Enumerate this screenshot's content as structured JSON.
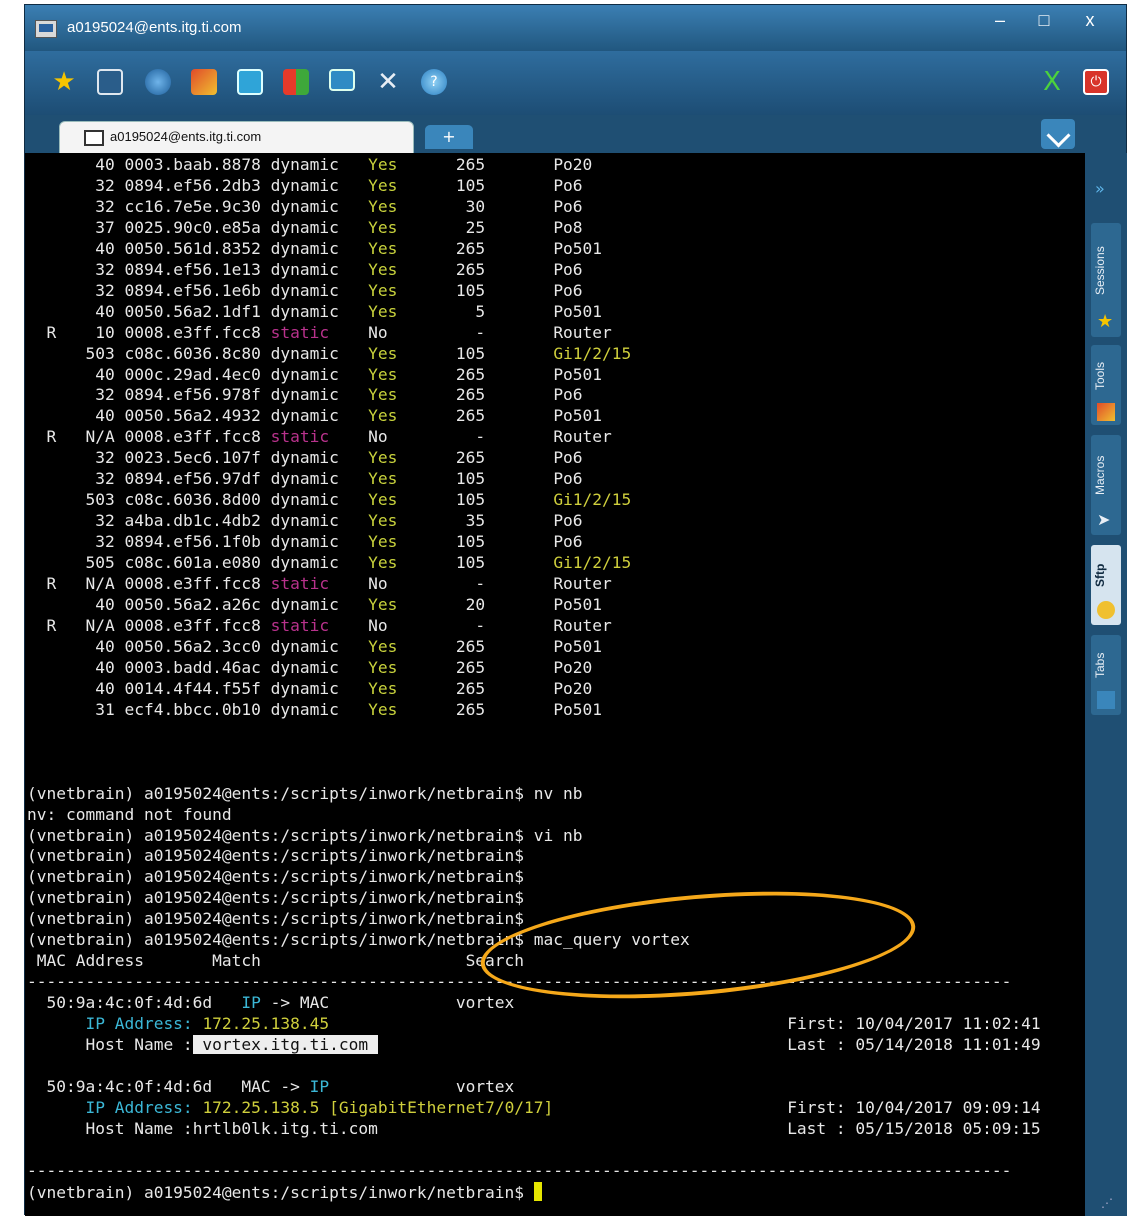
{
  "window": {
    "title": "a0195024@ents.itg.ti.com",
    "minimize": "–",
    "maximize": "□",
    "close": "x"
  },
  "toolbar": {
    "icons": [
      "star-icon",
      "sessions-icon",
      "globe-icon",
      "tools-icon",
      "terminal-icon",
      "layout-icon",
      "monitor-icon",
      "wrench-icon",
      "help-icon",
      "x-icon",
      "power-icon"
    ]
  },
  "tabs": {
    "active": "a0195024@ents.itg.ti.com",
    "new_tab": "+"
  },
  "sidebar": {
    "collapse": "»",
    "items": [
      "Sessions",
      "Tools",
      "Macros",
      "Sftp",
      "Tabs"
    ]
  },
  "terminal": {
    "mac_table": [
      {
        "flag": " ",
        "vlan": "40",
        "mac": "0003.baab.8878",
        "type": "dynamic",
        "secure": "Yes",
        "age": "265",
        "port": "Po20"
      },
      {
        "flag": " ",
        "vlan": "32",
        "mac": "0894.ef56.2db3",
        "type": "dynamic",
        "secure": "Yes",
        "age": "105",
        "port": "Po6"
      },
      {
        "flag": " ",
        "vlan": "32",
        "mac": "cc16.7e5e.9c30",
        "type": "dynamic",
        "secure": "Yes",
        "age": "30",
        "port": "Po6"
      },
      {
        "flag": " ",
        "vlan": "37",
        "mac": "0025.90c0.e85a",
        "type": "dynamic",
        "secure": "Yes",
        "age": "25",
        "port": "Po8"
      },
      {
        "flag": " ",
        "vlan": "40",
        "mac": "0050.561d.8352",
        "type": "dynamic",
        "secure": "Yes",
        "age": "265",
        "port": "Po501"
      },
      {
        "flag": " ",
        "vlan": "32",
        "mac": "0894.ef56.1e13",
        "type": "dynamic",
        "secure": "Yes",
        "age": "265",
        "port": "Po6"
      },
      {
        "flag": " ",
        "vlan": "32",
        "mac": "0894.ef56.1e6b",
        "type": "dynamic",
        "secure": "Yes",
        "age": "105",
        "port": "Po6"
      },
      {
        "flag": " ",
        "vlan": "40",
        "mac": "0050.56a2.1df1",
        "type": "dynamic",
        "secure": "Yes",
        "age": "5",
        "port": "Po501"
      },
      {
        "flag": "R",
        "vlan": "10",
        "mac": "0008.e3ff.fcc8",
        "type": "static",
        "secure": "No",
        "age": "-",
        "port": "Router"
      },
      {
        "flag": " ",
        "vlan": "503",
        "mac": "c08c.6036.8c80",
        "type": "dynamic",
        "secure": "Yes",
        "age": "105",
        "port": "Gi1/2/15"
      },
      {
        "flag": " ",
        "vlan": "40",
        "mac": "000c.29ad.4ec0",
        "type": "dynamic",
        "secure": "Yes",
        "age": "265",
        "port": "Po501"
      },
      {
        "flag": " ",
        "vlan": "32",
        "mac": "0894.ef56.978f",
        "type": "dynamic",
        "secure": "Yes",
        "age": "265",
        "port": "Po6"
      },
      {
        "flag": " ",
        "vlan": "40",
        "mac": "0050.56a2.4932",
        "type": "dynamic",
        "secure": "Yes",
        "age": "265",
        "port": "Po501"
      },
      {
        "flag": "R",
        "vlan": "N/A",
        "mac": "0008.e3ff.fcc8",
        "type": "static",
        "secure": "No",
        "age": "-",
        "port": "Router"
      },
      {
        "flag": " ",
        "vlan": "32",
        "mac": "0023.5ec6.107f",
        "type": "dynamic",
        "secure": "Yes",
        "age": "265",
        "port": "Po6"
      },
      {
        "flag": " ",
        "vlan": "32",
        "mac": "0894.ef56.97df",
        "type": "dynamic",
        "secure": "Yes",
        "age": "105",
        "port": "Po6"
      },
      {
        "flag": " ",
        "vlan": "503",
        "mac": "c08c.6036.8d00",
        "type": "dynamic",
        "secure": "Yes",
        "age": "105",
        "port": "Gi1/2/15"
      },
      {
        "flag": " ",
        "vlan": "32",
        "mac": "a4ba.db1c.4db2",
        "type": "dynamic",
        "secure": "Yes",
        "age": "35",
        "port": "Po6"
      },
      {
        "flag": " ",
        "vlan": "32",
        "mac": "0894.ef56.1f0b",
        "type": "dynamic",
        "secure": "Yes",
        "age": "105",
        "port": "Po6"
      },
      {
        "flag": " ",
        "vlan": "505",
        "mac": "c08c.601a.e080",
        "type": "dynamic",
        "secure": "Yes",
        "age": "105",
        "port": "Gi1/2/15"
      },
      {
        "flag": "R",
        "vlan": "N/A",
        "mac": "0008.e3ff.fcc8",
        "type": "static",
        "secure": "No",
        "age": "-",
        "port": "Router"
      },
      {
        "flag": " ",
        "vlan": "40",
        "mac": "0050.56a2.a26c",
        "type": "dynamic",
        "secure": "Yes",
        "age": "20",
        "port": "Po501"
      },
      {
        "flag": "R",
        "vlan": "N/A",
        "mac": "0008.e3ff.fcc8",
        "type": "static",
        "secure": "No",
        "age": "-",
        "port": "Router"
      },
      {
        "flag": " ",
        "vlan": "40",
        "mac": "0050.56a2.3cc0",
        "type": "dynamic",
        "secure": "Yes",
        "age": "265",
        "port": "Po501"
      },
      {
        "flag": " ",
        "vlan": "40",
        "mac": "0003.badd.46ac",
        "type": "dynamic",
        "secure": "Yes",
        "age": "265",
        "port": "Po20"
      },
      {
        "flag": " ",
        "vlan": "40",
        "mac": "0014.4f44.f55f",
        "type": "dynamic",
        "secure": "Yes",
        "age": "265",
        "port": "Po20"
      },
      {
        "flag": " ",
        "vlan": "31",
        "mac": "ecf4.bbcc.0b10",
        "type": "dynamic",
        "secure": "Yes",
        "age": "265",
        "port": "Po501"
      }
    ],
    "prompt": "(vnetbrain) a0195024@ents:/scripts/inwork/netbrain$",
    "commands": [
      {
        "cmd": "nv nb",
        "output": "nv: command not found"
      },
      {
        "cmd": "vi nb",
        "output": ""
      },
      {
        "cmd": "",
        "output": ""
      },
      {
        "cmd": "",
        "output": ""
      },
      {
        "cmd": "",
        "output": ""
      },
      {
        "cmd": "",
        "output": ""
      },
      {
        "cmd": "mac_query vortex",
        "output": ""
      }
    ],
    "query_headers": {
      "mac": "MAC Address",
      "match": "Match",
      "search": "Search"
    },
    "results": [
      {
        "mac": "50:9a:4c:0f:4d:6d",
        "match_left": "IP",
        "match_arrow": " -> ",
        "match_right": "MAC",
        "search": "vortex",
        "ip_label": "IP Address:",
        "ip": "172.25.138.45",
        "ip_extra": "",
        "host_label": "Host Name :",
        "host": " vortex.itg.ti.com ",
        "first_label": "First:",
        "first": "10/04/2017 11:02:41",
        "last_label": "Last :",
        "last": "05/14/2018 11:01:49"
      },
      {
        "mac": "50:9a:4c:0f:4d:6d",
        "match_left": "MAC",
        "match_arrow": " -> ",
        "match_right": "IP",
        "search": "vortex",
        "ip_label": "IP Address:",
        "ip": "172.25.138.5",
        "ip_extra": "[GigabitEthernet7/0/17]",
        "host_label": "Host Name :",
        "host": "hrtlb0lk.itg.ti.com",
        "first_label": "First:",
        "first": "10/04/2017 09:09:14",
        "last_label": "Last :",
        "last": "05/15/2018 05:09:15"
      }
    ],
    "separator": "-----------------------------------------------------------------------------------------------------"
  }
}
